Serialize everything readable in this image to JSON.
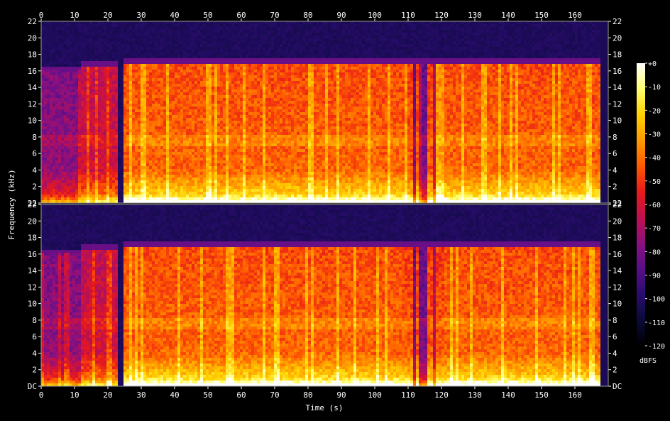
{
  "chart_data": {
    "type": "heatmap",
    "xlabel": "Time (s)",
    "ylabel": "Frequency (kHz)",
    "colorbar_label": "dBFS",
    "xlim": [
      0,
      170
    ],
    "ylim": [
      0,
      22
    ],
    "x_ticks": [
      0,
      10,
      20,
      30,
      40,
      50,
      60,
      70,
      80,
      90,
      100,
      110,
      120,
      130,
      140,
      150,
      160
    ],
    "x_tick_labels": [
      "0",
      "10",
      "20",
      "30",
      "40",
      "50",
      "60",
      "70",
      "80",
      "90",
      "100",
      "110",
      "120",
      "130",
      "140",
      "150",
      "160"
    ],
    "y_ticks": [
      0,
      2,
      4,
      6,
      8,
      10,
      12,
      14,
      16,
      18,
      20,
      22
    ],
    "y_tick_labels_top_channel": [
      "22",
      "2",
      "4",
      "6",
      "8",
      "10",
      "12",
      "14",
      "16",
      "18",
      "20",
      "22"
    ],
    "y_tick_labels_bottom_channel": [
      "DC",
      "2",
      "4",
      "6",
      "8",
      "10",
      "12",
      "14",
      "16",
      "18",
      "20",
      "22"
    ],
    "colorbar_ticks": [
      "+0",
      "-10",
      "-20",
      "-30",
      "-40",
      "-50",
      "-60",
      "-70",
      "-80",
      "-90",
      "-100",
      "-110",
      "-120"
    ],
    "colorbar_range": [
      -120,
      0
    ],
    "colormap": [
      "#000000",
      "#0a0a3a",
      "#2a0c6e",
      "#5a0f8a",
      "#8c107e",
      "#c0104e",
      "#e81a1a",
      "#ff5a00",
      "#ff9a00",
      "#ffd200",
      "#ffff70",
      "#ffffff"
    ],
    "channels": [
      {
        "segments": [
          {
            "start": 0,
            "end": 12,
            "level": "low-moderate",
            "cutoff_khz": 16
          },
          {
            "start": 12,
            "end": 23,
            "level": "moderate",
            "cutoff_khz": 16.6
          },
          {
            "start": 23,
            "end": 24.5,
            "level": "silent",
            "cutoff_khz": 0
          },
          {
            "start": 24.5,
            "end": 109,
            "level": "loud",
            "cutoff_khz": 16.8
          },
          {
            "start": 109,
            "end": 121,
            "level": "mixed",
            "cutoff_khz": 16.8
          },
          {
            "start": 121,
            "end": 168,
            "level": "loud",
            "cutoff_khz": 16.8
          }
        ]
      },
      {
        "segments": [
          {
            "start": 0,
            "end": 12,
            "level": "low-moderate",
            "cutoff_khz": 16
          },
          {
            "start": 12,
            "end": 23,
            "level": "moderate",
            "cutoff_khz": 16.6
          },
          {
            "start": 23,
            "end": 24.5,
            "level": "silent",
            "cutoff_khz": 0
          },
          {
            "start": 24.5,
            "end": 109,
            "level": "loud",
            "cutoff_khz": 16.8
          },
          {
            "start": 109,
            "end": 121,
            "level": "mixed",
            "cutoff_khz": 16.8
          },
          {
            "start": 121,
            "end": 168,
            "level": "loud",
            "cutoff_khz": 16.8
          }
        ]
      }
    ]
  }
}
